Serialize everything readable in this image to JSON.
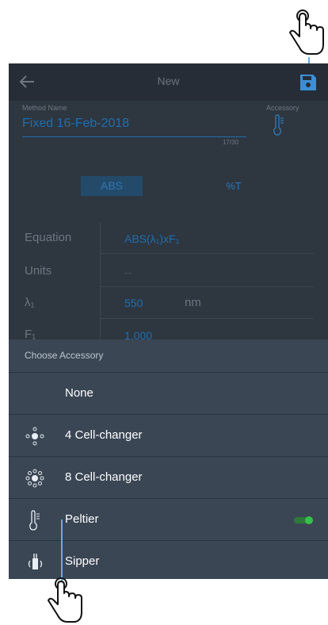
{
  "appbar": {
    "title": "New",
    "back_icon": "arrow-left-icon",
    "save_icon": "floppy-disk-icon"
  },
  "method": {
    "label": "Method Name",
    "value": "Fixed 16-Feb-2018",
    "count": "17/30"
  },
  "accessory": {
    "label": "Accessory",
    "icon": "thermometer-icon"
  },
  "mode_tabs": {
    "abs": "ABS",
    "pct": "%T",
    "selected": "ABS"
  },
  "table": {
    "equation_label": "Equation",
    "equation_value": "ABS(λ₁)xF₁",
    "units_label": "Units",
    "units_value": "--",
    "lambda_label": "λ₁",
    "lambda_value": "550",
    "lambda_unit": "nm",
    "f_label": "F₁",
    "f_value": "1.000"
  },
  "sheet": {
    "title": "Choose Accessory",
    "options": [
      {
        "label": "None",
        "icon": ""
      },
      {
        "label": "4 Cell-changer",
        "icon": "four-cell-changer-icon"
      },
      {
        "label": "8 Cell-changer",
        "icon": "eight-cell-changer-icon"
      },
      {
        "label": "Peltier",
        "icon": "thermometer-icon",
        "toggle_on": true
      },
      {
        "label": "Sipper",
        "icon": "sipper-icon"
      }
    ]
  },
  "colors": {
    "accent": "#1f6fae",
    "toggle": "#35c14a",
    "sheet_bg": "#3a4654",
    "screen_bg": "#2e3640"
  }
}
